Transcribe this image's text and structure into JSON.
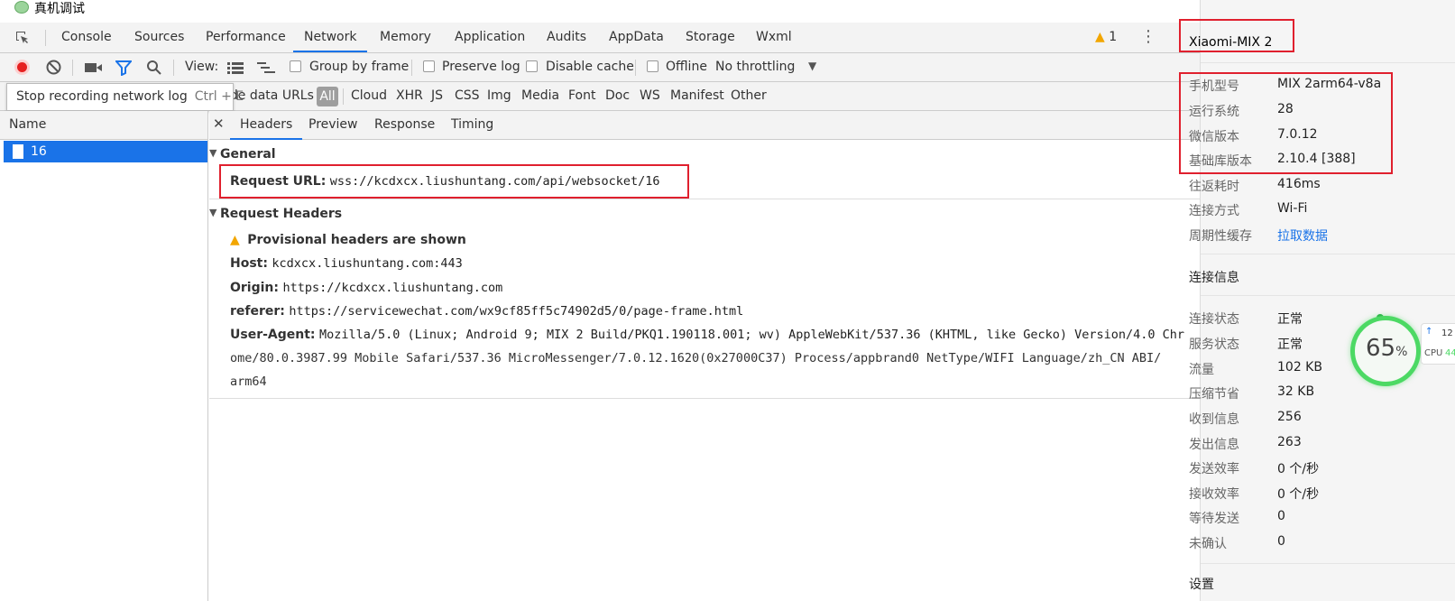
{
  "window": {
    "title": "真机调试"
  },
  "tabs": [
    {
      "label": "Console"
    },
    {
      "label": "Sources"
    },
    {
      "label": "Performance"
    },
    {
      "label": "Network",
      "active": true
    },
    {
      "label": "Memory"
    },
    {
      "label": "Application"
    },
    {
      "label": "Audits"
    },
    {
      "label": "AppData"
    },
    {
      "label": "Storage"
    },
    {
      "label": "Wxml"
    }
  ],
  "warnings": {
    "count": "1"
  },
  "toolbar": {
    "view_label": "View:",
    "group_by_frame": "Group by frame",
    "preserve_log": "Preserve log",
    "disable_cache": "Disable cache",
    "offline": "Offline",
    "throttling": "No throttling"
  },
  "filterbar": {
    "hide_data_urls": "ide data URLs",
    "types": [
      "All",
      "Cloud",
      "XHR",
      "JS",
      "CSS",
      "Img",
      "Media",
      "Font",
      "Doc",
      "WS",
      "Manifest",
      "Other"
    ]
  },
  "tooltip": {
    "text": "Stop recording network log",
    "shortcut": "Ctrl + E"
  },
  "requests": {
    "column": "Name",
    "items": [
      {
        "name": "16"
      }
    ]
  },
  "detail_tabs": [
    "Headers",
    "Preview",
    "Response",
    "Timing"
  ],
  "general": {
    "title": "General",
    "request_url_label": "Request URL:",
    "request_url": "wss://kcdxcx.liushuntang.com/api/websocket/16"
  },
  "request_headers": {
    "title": "Request Headers",
    "provisional": "Provisional headers are shown",
    "host_label": "Host:",
    "host": "kcdxcx.liushuntang.com:443",
    "origin_label": "Origin:",
    "origin": "https://kcdxcx.liushuntang.com",
    "referer_label": "referer:",
    "referer": "https://servicewechat.com/wx9cf85ff5c74902d5/0/page-frame.html",
    "ua_label": "User-Agent:",
    "ua_line1": "Mozilla/5.0 (Linux; Android 9; MIX 2 Build/PKQ1.190118.001; wv) AppleWebKit/537.36 (KHTML, like Gecko) Version/4.0 Chr",
    "ua_line2": "ome/80.0.3987.99 Mobile Safari/537.36 MicroMessenger/7.0.12.1620(0x27000C37) Process/appbrand0 NetType/WIFI Language/zh_CN ABI/",
    "ua_line3": "arm64"
  },
  "device": {
    "name": "Xiaomi-MIX 2",
    "info": [
      {
        "label": "手机型号",
        "value": "MIX 2arm64-v8a"
      },
      {
        "label": "运行系统",
        "value": "28"
      },
      {
        "label": "微信版本",
        "value": "7.0.12"
      },
      {
        "label": "基础库版本",
        "value": "2.10.4 [388]"
      },
      {
        "label": "往返耗时",
        "value": "416ms"
      },
      {
        "label": "连接方式",
        "value": "Wi-Fi"
      },
      {
        "label": "周期性缓存",
        "value": "拉取数据"
      }
    ],
    "conn_title": "连接信息",
    "conn": [
      {
        "label": "连接状态",
        "value": "正常"
      },
      {
        "label": "服务状态",
        "value": "正常"
      },
      {
        "label": "流量",
        "value": "102 KB"
      },
      {
        "label": "压缩节省",
        "value": "32 KB"
      },
      {
        "label": "收到信息",
        "value": "256"
      },
      {
        "label": "发出信息",
        "value": "263"
      },
      {
        "label": "发送效率",
        "value": "0 个/秒"
      },
      {
        "label": "接收效率",
        "value": "0 个/秒"
      },
      {
        "label": "等待发送",
        "value": "0"
      },
      {
        "label": "未确认",
        "value": "0"
      }
    ],
    "settings_title": "设置"
  },
  "overlay": {
    "percent": "65",
    "percent_sign": "%",
    "cpu_label": "CPU",
    "cpu_value": "44",
    "net_value": "12"
  },
  "colors": {
    "accent": "#1a73e8",
    "highlight": "#e0202e",
    "gauge": "#4cd964"
  }
}
